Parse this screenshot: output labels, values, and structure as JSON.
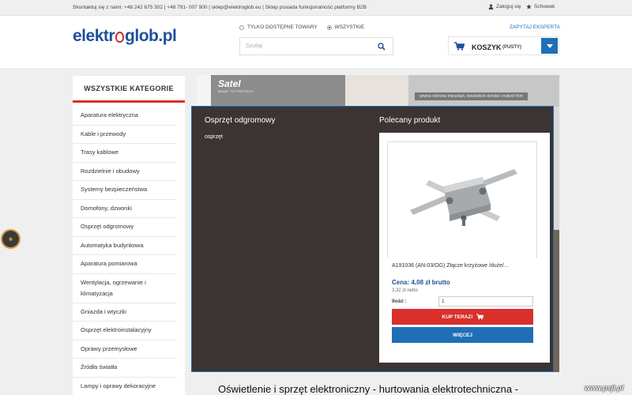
{
  "topbar": {
    "contact": "Skontaktuj się z nami: +48 242 675 302 | +48 791- 007 900 | sklep@elektroglob.eu | Sklep posiada funkcjonalność platformy B2B",
    "login": "Zaloguj się",
    "favorites": "Schowek"
  },
  "header": {
    "logo_left": "elektr",
    "logo_right": "glob.pl",
    "radio_only_available": "TYLKO DOSTĘPNE TOWARY",
    "radio_all": "WSZYSTKIE",
    "ask_expert": "ZAPYTAJ EKSPERTA",
    "search_placeholder": "Szukaj",
    "cart_label": "KOSZYK",
    "cart_status": "(PUSTY)"
  },
  "sidebar": {
    "title": "WSZYSTKIE KATEGORIE",
    "items": [
      "Aparatura elektryczna",
      "Kable i przewody",
      "Trasy kablowe",
      "Rozdzielnie i obudowy",
      "Systemy bezpieczeństwa",
      "Domofony, dzwonki",
      "Osprzęt odgromowy",
      "Automatyka budynkowa",
      "Aparatura pomiarowa",
      "Wentylacja, ogrzewanie i klimatyzacja",
      "Gniazda i wtyczki",
      "Osprzęt elektroinstalacyjny",
      "Oprawy przemysłowe",
      "Źródła światła",
      "Lampy i oprawy dekoracyjne"
    ]
  },
  "banner": {
    "brand": "Satel",
    "brand_sub": "MADE TO PROTECT",
    "tag": "pewna ochrona mieszkań, niewielkich domów i małych firm"
  },
  "mega": {
    "heading": "Osprzęt odgromowy",
    "subitem": "osprzęt",
    "featured_heading": "Polecany produkt"
  },
  "product": {
    "name": "A191036 (AN-03/OG) Złącze krzyżowe /duże/...",
    "price": "Cena: 4,08 zł brutto",
    "net": "3,32 zł netto",
    "qty_label": "Ilość :",
    "qty_value": "1",
    "buy_label": "KUP TERAZ!",
    "more_label": "WIĘCEJ"
  },
  "footer": {
    "headline": "Oświetlenie i sprzęt elektroniczny - hurtowania elektrotechniczna -"
  },
  "watermark": "www.psji.pl",
  "colors": {
    "brand_blue": "#1f4f99",
    "accent_red": "#d9302c",
    "button_blue": "#1f6fb7",
    "menu_dark": "#3b3433"
  }
}
